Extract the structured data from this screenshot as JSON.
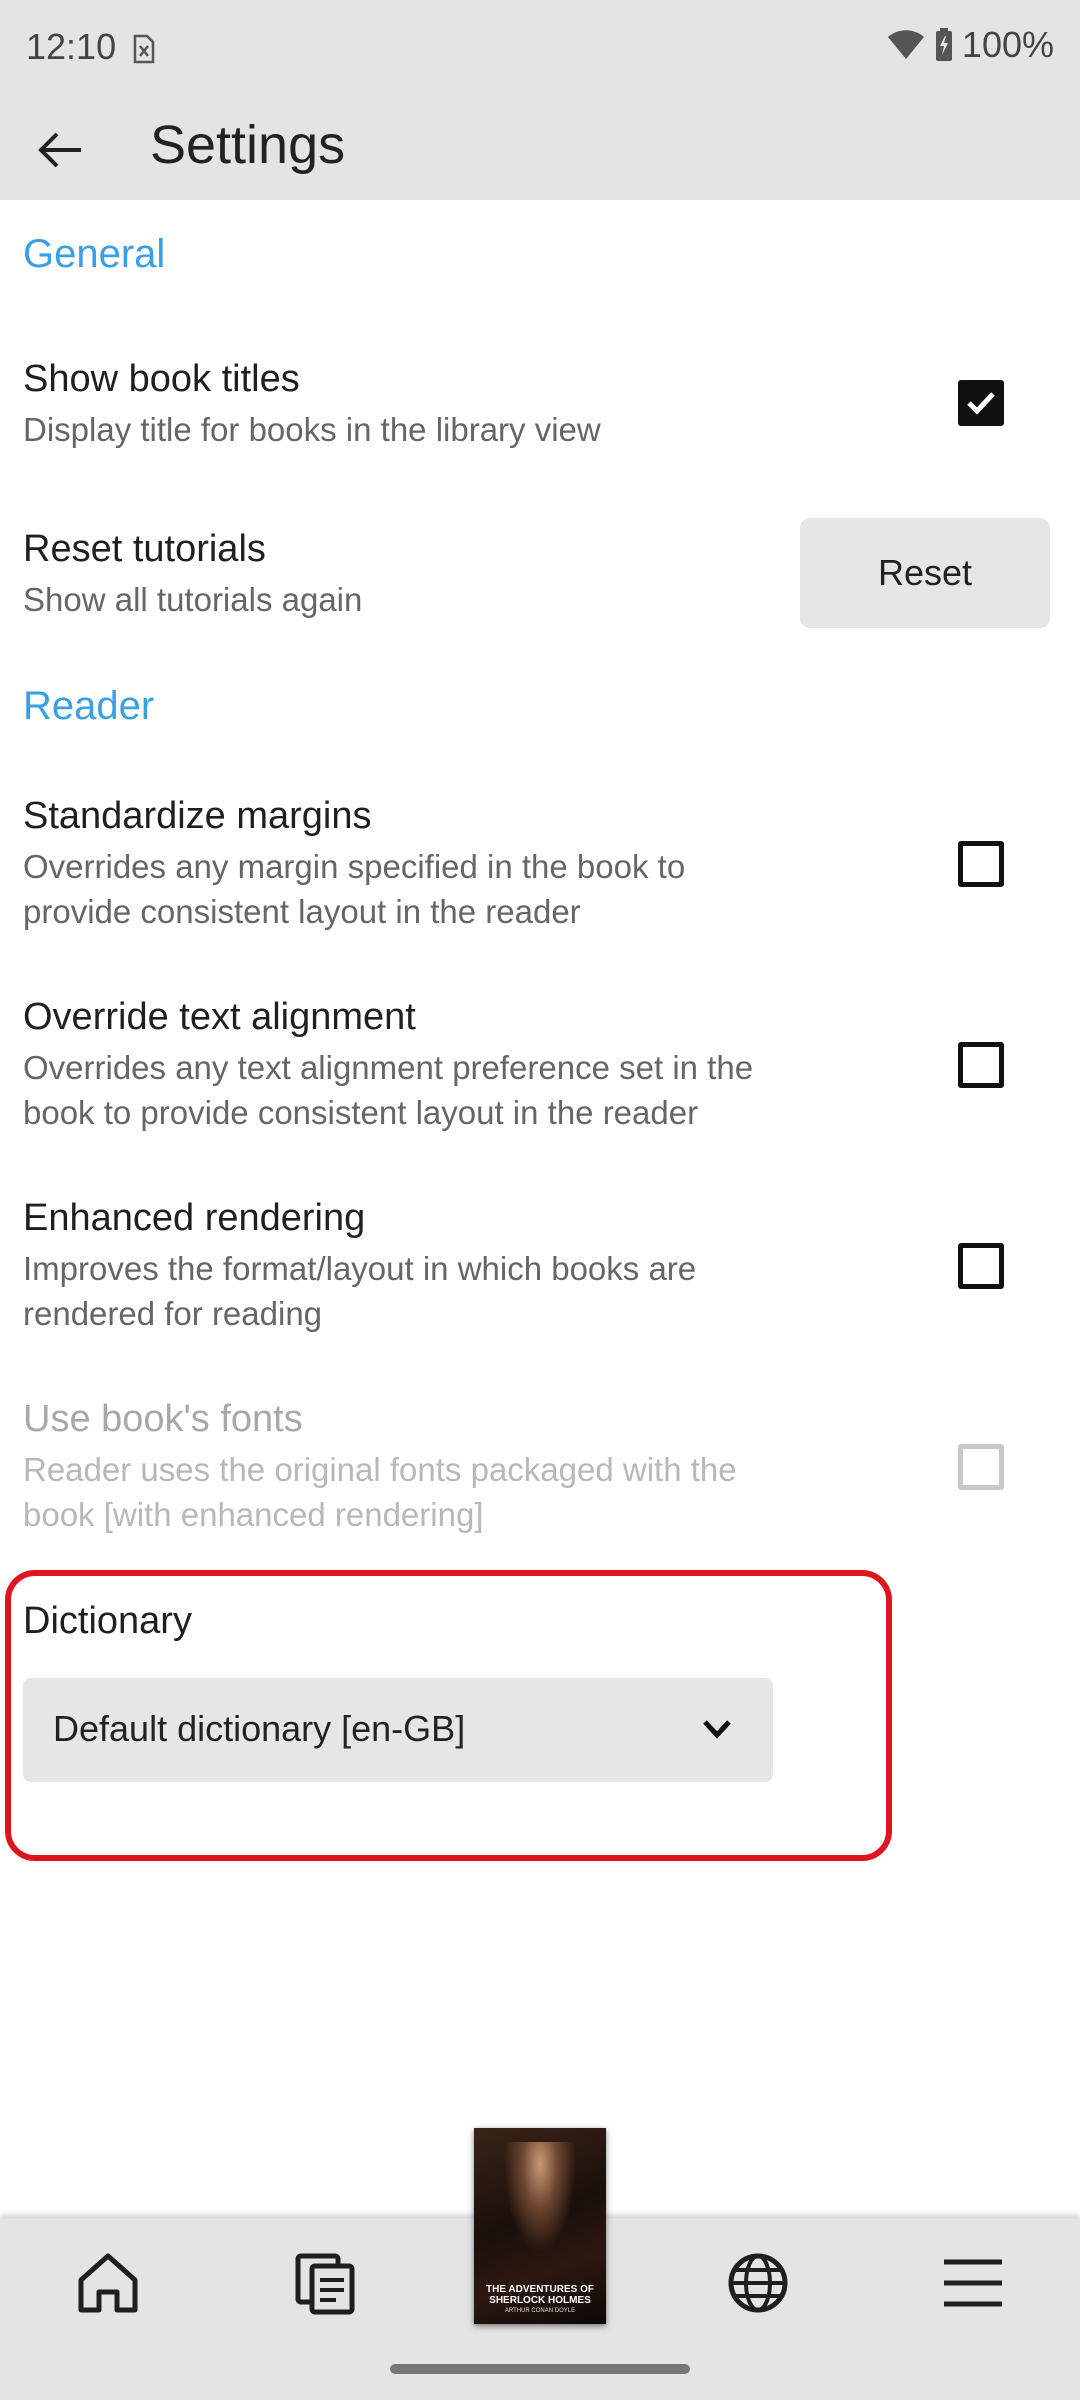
{
  "status_bar": {
    "time": "12:10",
    "battery": "100%",
    "icons": [
      "sim-off-icon",
      "wifi-icon",
      "battery-charging-icon"
    ]
  },
  "app_bar": {
    "title": "Settings",
    "back_icon": "arrow-left-icon"
  },
  "sections": {
    "general": {
      "header": "General",
      "show_titles": {
        "title": "Show book titles",
        "subtitle": "Display title for books in the library view",
        "checked": true
      },
      "reset_tutorials": {
        "title": "Reset tutorials",
        "subtitle": "Show all tutorials again",
        "button_label": "Reset"
      }
    },
    "reader": {
      "header": "Reader",
      "standardize_margins": {
        "title": "Standardize margins",
        "subtitle": "Overrides any margin specified in the book to provide consistent layout in the reader",
        "checked": false
      },
      "override_alignment": {
        "title": "Override text alignment",
        "subtitle": "Overrides any text alignment preference set in the book to provide consistent layout in the reader",
        "checked": false
      },
      "enhanced_rendering": {
        "title": "Enhanced rendering",
        "subtitle": "Improves the format/layout in which books are rendered for reading",
        "checked": false
      },
      "book_fonts": {
        "title": "Use book's fonts",
        "subtitle": "Reader uses the original fonts packaged with the book [with enhanced rendering]",
        "checked": false,
        "disabled": true
      }
    },
    "dictionary": {
      "label": "Dictionary",
      "selected": "Default dictionary [en-GB]"
    }
  },
  "bottom_nav": {
    "items": [
      "home-icon",
      "library-icon",
      "current-book",
      "globe-icon",
      "menu-icon"
    ],
    "current_book": {
      "title": "THE ADVENTURES OF SHERLOCK HOLMES",
      "author": "ARTHUR CONAN DOYLE"
    }
  },
  "colors": {
    "accent": "#3aa0e6",
    "highlight": "#e0141f",
    "bar_bg": "#e4e4e4"
  }
}
